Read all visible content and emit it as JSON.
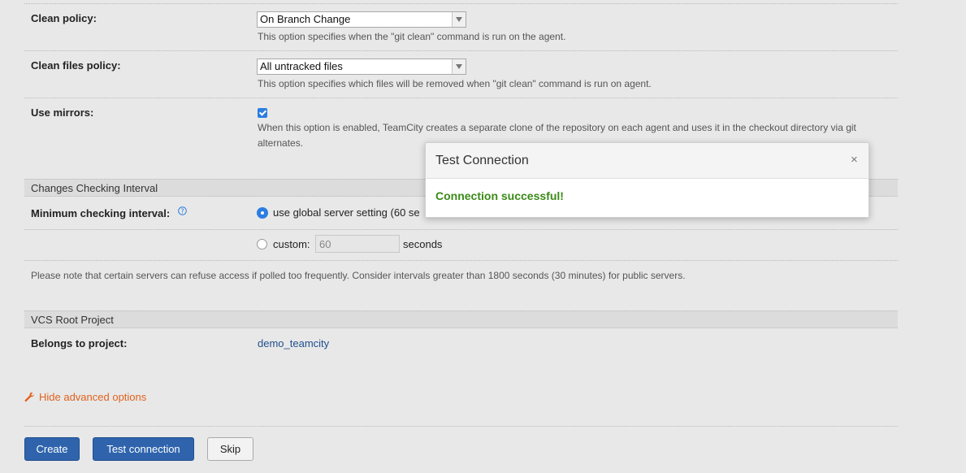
{
  "clean_policy": {
    "label": "Clean policy:",
    "value": "On Branch Change",
    "hint": "This option specifies when the \"git clean\" command is run on the agent."
  },
  "clean_files_policy": {
    "label": "Clean files policy:",
    "value": "All untracked files",
    "hint": "This option specifies which files will be removed when \"git clean\" command is run on agent."
  },
  "use_mirrors": {
    "label": "Use mirrors:",
    "checked": true,
    "hint_line1": "When this option is enabled, TeamCity creates a separate clone of the repository on each agent and uses it in the checkout directory via git",
    "hint_line2": "alternates."
  },
  "changes_checking": {
    "section_title": "Changes Checking Interval",
    "label": "Minimum checking interval:",
    "help_icon": "question-circle-icon",
    "option_global": "use global server setting (60 se",
    "option_custom": "custom:",
    "custom_value": "60",
    "custom_unit": "seconds",
    "selected": "global",
    "note": "Please note that certain servers can refuse access if polled too frequently. Consider intervals greater than 1800 seconds (30 minutes) for public servers."
  },
  "vcs_root_project": {
    "section_title": "VCS Root Project",
    "label": "Belongs to project:",
    "project_link": "demo_teamcity"
  },
  "advanced": {
    "icon": "wrench-icon",
    "label": "Hide advanced options"
  },
  "buttons": {
    "create": "Create",
    "test_connection": "Test connection",
    "skip": "Skip"
  },
  "modal": {
    "title": "Test Connection",
    "close": "×",
    "message": "Connection successful!"
  },
  "colors": {
    "primary_button": "#2f64ad",
    "link": "#1f4f8f",
    "advanced_link": "#e0621e",
    "success": "#3a8a17",
    "checkbox_accent": "#2b7de0"
  }
}
